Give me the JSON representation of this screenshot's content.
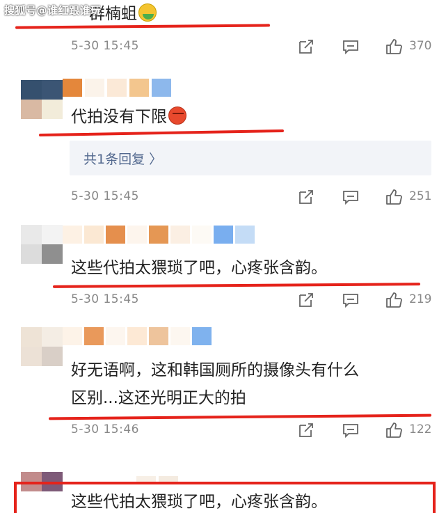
{
  "watermark": "搜狐号@谁红跟谁玩",
  "colors": {
    "accent_red": "#e5231b",
    "meta_gray": "#888888",
    "reply_blue": "#53698f"
  },
  "comments": [
    {
      "text": "群楠蛆",
      "emoji": "nauseated-face-icon",
      "time": "5-30 15:45",
      "likes": "370"
    },
    {
      "text": "代拍没有下限",
      "emoji": "angry-face-icon",
      "time": "5-30 15:45",
      "likes": "251",
      "reply_label": "共1条回复 〉"
    },
    {
      "text": "这些代拍太猥琐了吧，心疼张含韵。",
      "time": "5-30 15:45",
      "likes": "219"
    },
    {
      "line1": "好无语啊，这和韩国厕所的摄像头有什么",
      "line2": "区别...这还光明正大的拍",
      "time": "5-30 15:46",
      "likes": "122"
    },
    {
      "text": "这些代拍太猥琐了吧，心疼张含韵。"
    }
  ]
}
